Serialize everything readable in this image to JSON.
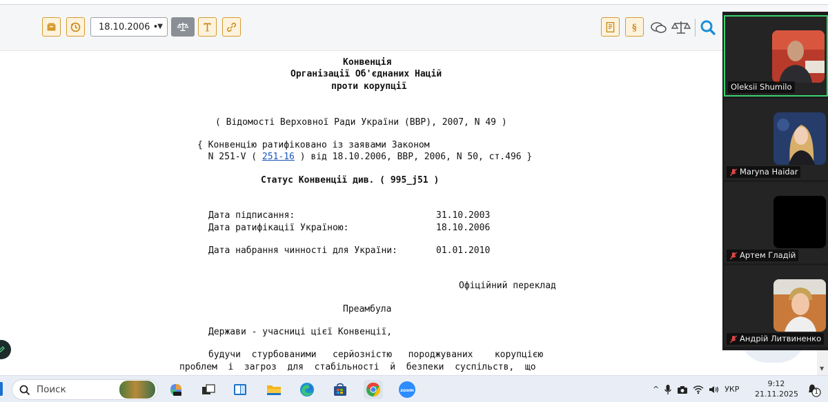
{
  "toolbar": {
    "date_value": "18.10.2006 •",
    "left_icons": [
      "archive-icon",
      "history-icon",
      "scales-icon",
      "text-icon",
      "link-icon"
    ],
    "right_icons": [
      "document-structure-icon",
      "paragraph-icon",
      "comments-icon",
      "compare-icon",
      "search-icon"
    ]
  },
  "document": {
    "title_lines": [
      "Конвенція",
      "Організації Об'єднаних Націй",
      "проти корупції"
    ],
    "source": "( Відомості Верховної Ради України (ВВР), 2007, N 49 )",
    "ratified_line1": "{ Конвенцію ратифіковано із заявами Законом",
    "ratified_line2_pre": "  N 251-V ( ",
    "ratified_link": "251-16",
    "ratified_line2_post": " ) від 18.10.2006, ВВР, 2006, N 50, ст.496 }",
    "status": "Статус Конвенції див. ( 995_j51 )",
    "dates": [
      {
        "label": "Дата підписання:",
        "value": "31.10.2003"
      },
      {
        "label": "Дата ратифікації Україною:",
        "value": "18.10.2006"
      },
      {
        "label": "Дата набрання чинності для України:",
        "value": "01.01.2010"
      }
    ],
    "official": "Офіційний переклад",
    "preamble": "Преамбула",
    "states": "Держави - учасниці цієї Конвенції,",
    "body_line1": "будучи  стурбованими   серйозністю   породжуваних    корупцією",
    "body_line2": "проблем  і  загроз  для  стабільності  й  безпеки  суспільств,  що"
  },
  "zoom": {
    "participants": [
      {
        "name": "Oleksii Shumilo",
        "muted": false,
        "active": true
      },
      {
        "name": "Maryna Haidar",
        "muted": true,
        "active": false
      },
      {
        "name": "Артем Гладій",
        "muted": true,
        "active": false
      },
      {
        "name": "Андрій Литвиненко",
        "muted": true,
        "active": false
      }
    ]
  },
  "taskbar": {
    "search_placeholder": "Поиск",
    "apps": [
      "copilot-icon",
      "task-view-icon",
      "widgets-icon",
      "file-explorer-icon",
      "edge-icon",
      "store-icon",
      "chrome-icon",
      "zoom-icon"
    ],
    "language": "УКР",
    "time": "9:12",
    "date": "21.11.2025",
    "notifications": "1"
  },
  "colors": {
    "accent_orange": "#d59a2e",
    "search_blue": "#1a8fd6",
    "link_blue": "#1a56b8",
    "active_speaker": "#3bd16f"
  }
}
